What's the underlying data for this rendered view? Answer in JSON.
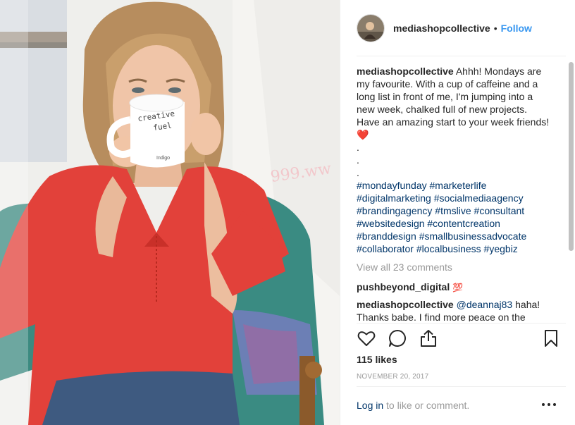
{
  "post": {
    "username": "mediashopcollective",
    "separator": "•",
    "follow_label": "Follow",
    "caption_text": " Ahhh! Mondays are my favourite. With a cup of caffeine and a long list in front of me, I'm jumping into a new week, chalked full of new projects. Have an amazing start to your week friends! ",
    "caption_emoji": "❤️",
    "dots": [
      ".",
      ".",
      "."
    ],
    "hashtag_lines": [
      "#mondayfunday #marketerlife",
      "#digitalmarketing #socialmediaagency",
      "#brandingagency #tmslive #consultant",
      "#websitedesign #contentcreation",
      "#branddesign #smallbusinessadvocate",
      "#collaborator #localbusiness #yegbiz"
    ],
    "view_all_comments": "View all 23 comments",
    "comments": [
      {
        "user": "pushbeyond_digital",
        "text": " ",
        "emoji": "💯"
      },
      {
        "user": "mediashopcollective",
        "mention": "@deannaj83",
        "text": " haha! Thanks babe. I find more peace on the"
      }
    ],
    "likes": "115 likes",
    "date": "NOVEMBER 20, 2017",
    "login_link": "Log in",
    "login_suffix": " to like or comment.",
    "more_glyph": "•••"
  },
  "mug": {
    "text_line1": "creative",
    "text_line2": "fuel",
    "bottom_logo": "Indigo"
  },
  "icons": {
    "like": "heart-outline-icon",
    "comment": "comment-bubble-icon",
    "share": "share-upload-icon",
    "save": "bookmark-icon",
    "more": "more-options-icon"
  },
  "colors": {
    "link_blue": "#3897f0",
    "hashtag": "#003569",
    "muted": "#999999",
    "text": "#262626",
    "shirt_red": "#e2413a"
  }
}
